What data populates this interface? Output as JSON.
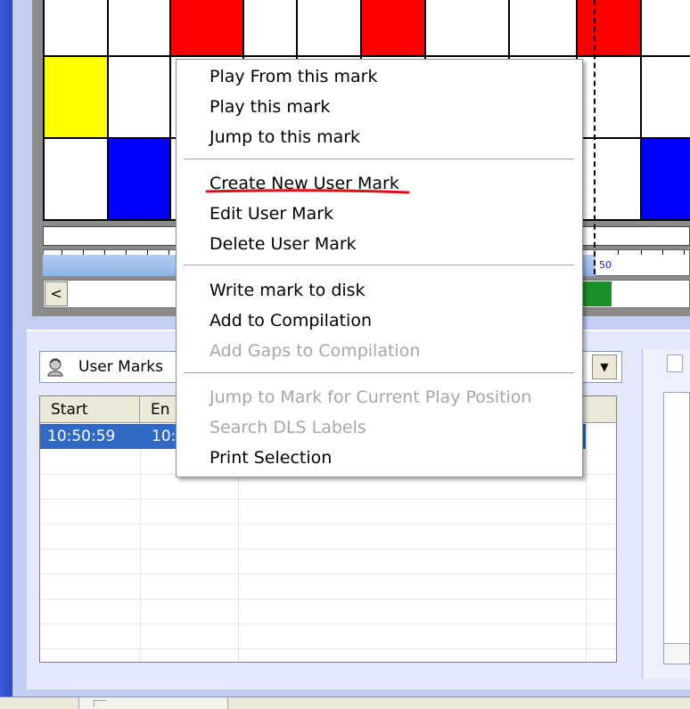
{
  "context_menu": {
    "items": [
      {
        "label": "Play From this mark",
        "enabled": true
      },
      {
        "label": "Play this mark",
        "enabled": true
      },
      {
        "label": "Jump to this mark",
        "enabled": true
      },
      {
        "label": "Create New User Mark",
        "enabled": true,
        "highlighted_with_red_underline": true
      },
      {
        "label": "Edit User Mark",
        "enabled": true
      },
      {
        "label": "Delete User Mark",
        "enabled": true
      },
      {
        "label": "Write mark to disk",
        "enabled": true
      },
      {
        "label": "Add to Compilation",
        "enabled": true
      },
      {
        "label": "Add Gaps to Compilation",
        "enabled": false
      },
      {
        "label": "Jump to Mark for Current Play Position",
        "enabled": false
      },
      {
        "label": "Search DLS Labels",
        "enabled": false
      },
      {
        "label": "Print Selection",
        "enabled": true
      }
    ]
  },
  "timeline": {
    "ruler_label": "50",
    "scroll_left_glyph": "<",
    "colors": {
      "red": "#ff0000",
      "yellow": "#ffff00",
      "blue": "#0000ff",
      "green": "#1a8f2a"
    }
  },
  "marks_panel": {
    "dropdown_value": "User Marks",
    "dropdown_icon": "user-head-icon",
    "columns": [
      "Start",
      "En"
    ],
    "rows": [
      {
        "start": "10:50:59",
        "end": "10:"
      }
    ]
  }
}
